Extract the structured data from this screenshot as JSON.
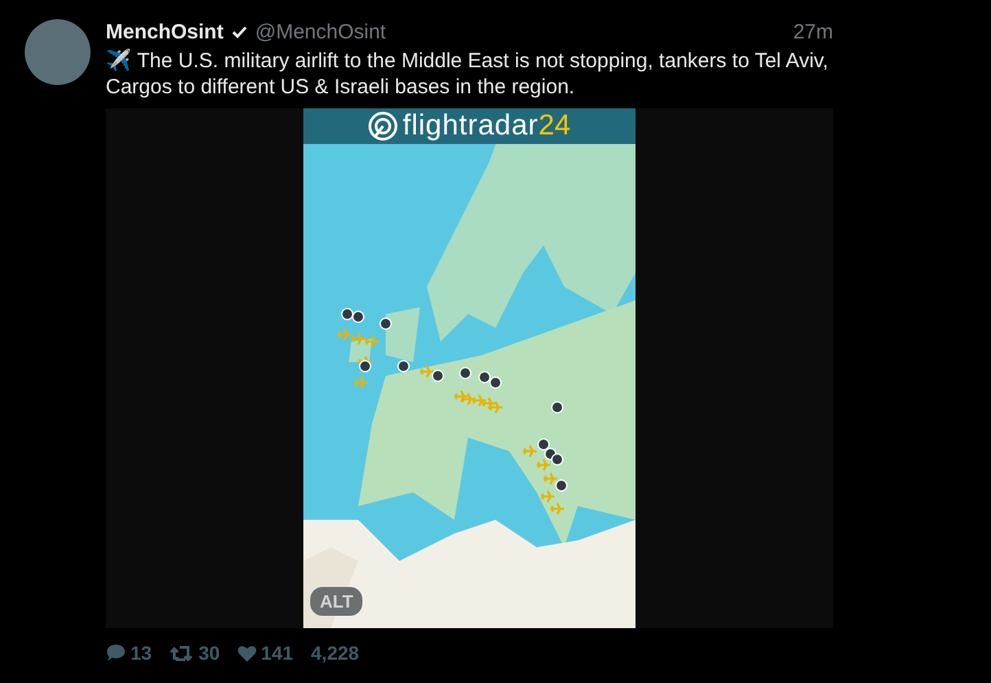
{
  "tweet": {
    "display_name": "MenchOsint",
    "verified": true,
    "handle": "@MenchOsint",
    "time": "27m",
    "text": "✈️ The U.S. military airlift to the Middle East is not stopping, tankers to Tel Aviv, Cargos to different US & Israeli bases in the region.",
    "media": {
      "logo_text": "flightradar",
      "logo_number": "24",
      "alt_badge": "ALT"
    },
    "actions": [
      {
        "kind": "reply",
        "count": "13"
      },
      {
        "kind": "retweet",
        "count": "30"
      },
      {
        "kind": "like",
        "count": "141"
      },
      {
        "kind": "views",
        "count": "4,228"
      }
    ]
  }
}
